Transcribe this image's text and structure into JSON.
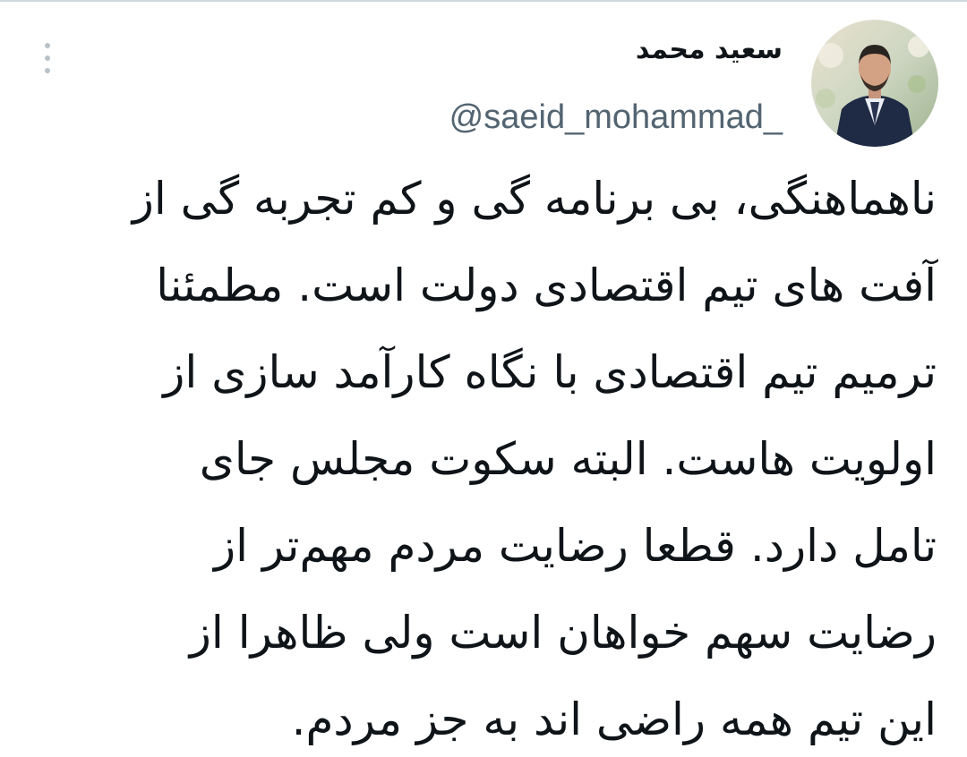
{
  "tweet": {
    "author": {
      "display_name": "سعید محمد",
      "handle": "@saeid_mohammad_"
    },
    "text_lines": [
      "ناهماهنگی، بی برنامه گی و کم تجربه گی از",
      "آفت های تیم اقتصادی دولت است. مطمئنا",
      "ترمیم تیم اقتصادی با نگاه کارآمد سازی از",
      "اولویت هاست. البته سکوت مجلس جای",
      "تامل دارد. قطعا رضایت مردم مهم‌تر از",
      "رضایت سهم خواهان است ولی ظاهرا از",
      "این تیم همه راضی اند به جز مردم."
    ]
  },
  "icons": {
    "more": "more-vertical-icon"
  },
  "colors": {
    "text_primary": "#0f1419",
    "text_secondary": "#536471",
    "divider": "#cfd9de"
  }
}
